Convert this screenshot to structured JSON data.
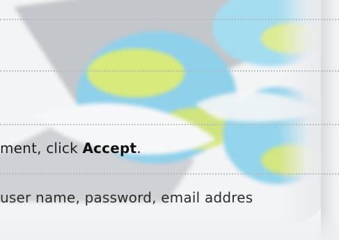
{
  "instructions": {
    "accept_prefix": "ment, click ",
    "accept_bold": "Accept",
    "accept_suffix": ".",
    "credentials_line": "user name, password, email addres"
  },
  "colors": {
    "background": "#f3f4f6",
    "text": "#1e1e1e",
    "dotted_rule": "#b4b8be",
    "artwork_blue": "#7ecde8",
    "artwork_green": "#d9e86a"
  },
  "icons": {
    "artwork": "blurred-globe-logo"
  }
}
